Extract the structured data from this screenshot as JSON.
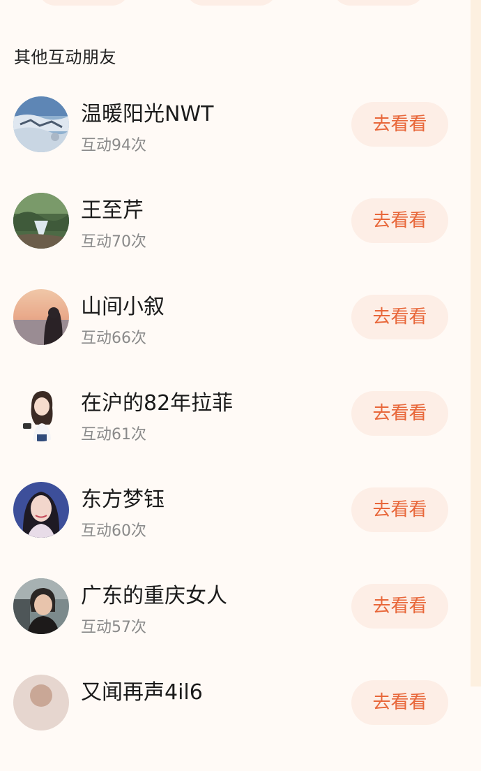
{
  "section": {
    "title": "其他互动朋友"
  },
  "friends": [
    {
      "name": "温暖阳光NWT",
      "count": "互动94次",
      "button": "去看看"
    },
    {
      "name": "王至芹",
      "count": "互动70次",
      "button": "去看看"
    },
    {
      "name": "山间小叙",
      "count": "互动66次",
      "button": "去看看"
    },
    {
      "name": "在沪的82年拉菲",
      "count": "互动61次",
      "button": "去看看"
    },
    {
      "name": "东方梦钰",
      "count": "互动60次",
      "button": "去看看"
    },
    {
      "name": "广东的重庆女人",
      "count": "互动57次",
      "button": "去看看"
    },
    {
      "name": "又闻再声4il6",
      "count": "",
      "button": "去看看"
    }
  ],
  "colors": {
    "accent": "#e8673a",
    "button_bg": "#fdeee6",
    "page_bg": "#fffaf6"
  }
}
